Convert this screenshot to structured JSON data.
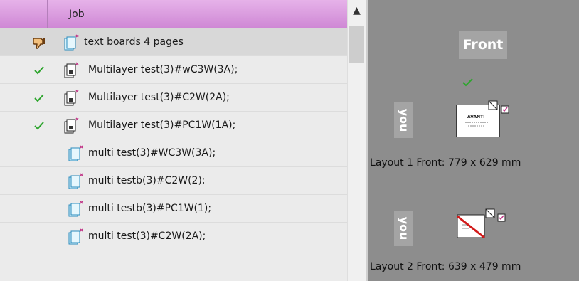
{
  "job_list": {
    "column_header": "Job",
    "rows": [
      {
        "name": "text boards 4 pages",
        "status": "rejected-thumb",
        "icon": "job-stack-icon",
        "selected": true
      },
      {
        "name": "Multilayer test(3)#wC3W(3A);",
        "status": "check",
        "icon": "multilayer-job-icon",
        "selected": false
      },
      {
        "name": "Multilayer test(3)#C2W(2A);",
        "status": "check",
        "icon": "multilayer-job-icon",
        "selected": false
      },
      {
        "name": "Multilayer test(3)#PC1W(1A);",
        "status": "check",
        "icon": "multilayer-job-icon",
        "selected": false
      },
      {
        "name": "multi test(3)#WC3W(3A);",
        "status": "none",
        "icon": "job-stack-icon",
        "selected": false
      },
      {
        "name": "multi testb(3)#C2W(2);",
        "status": "none",
        "icon": "job-stack-icon",
        "selected": false
      },
      {
        "name": "multi testb(3)#PC1W(1);",
        "status": "none",
        "icon": "job-stack-icon",
        "selected": false
      },
      {
        "name": "multi test(3)#C2W(2A);",
        "status": "none",
        "icon": "job-stack-icon",
        "selected": false
      }
    ]
  },
  "preview": {
    "side_label": "Front",
    "you_label": "you",
    "card_text": "AVANTI",
    "layouts": [
      {
        "label": "Layout 1 Front: 779 x 629 mm",
        "thumbnail": "card-preview",
        "approved": true
      },
      {
        "label": "Layout 2 Front: 639 x 479 mm",
        "thumbnail": "missing-preview",
        "approved": false
      }
    ]
  },
  "colors": {
    "header_gradient_top": "#e6b2e9",
    "header_gradient_bottom": "#cf88d5",
    "check_green": "#2ea52e",
    "preview_bg": "#8d8d8d",
    "missing_red": "#d21a1a"
  },
  "icons": {
    "scroll_up": "▲"
  }
}
